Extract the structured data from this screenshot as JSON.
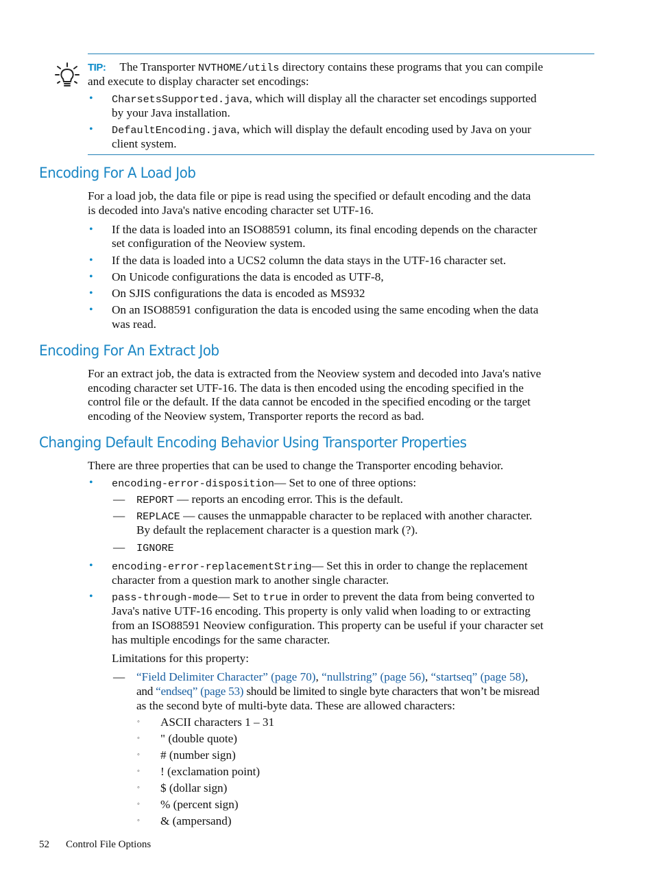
{
  "tip": {
    "label": "TIP:",
    "intro_prefix": "The Transporter ",
    "intro_code": "NVTHOME/utils",
    "intro_suffix": " directory contains these programs that you can compile",
    "intro_line2": "and execute to display character set encodings:",
    "items": [
      {
        "code": "CharsetsSupported.java",
        "text1": ", which will display all the character set encodings supported",
        "text2": "by your Java installation."
      },
      {
        "code": "DefaultEncoding.java",
        "text1": ", which will display the default encoding used by Java on your",
        "text2": "client system."
      }
    ]
  },
  "load_job": {
    "heading": "Encoding For A Load Job",
    "para": [
      "For a load job, the data file or pipe is read using the specified or default encoding and the data",
      "is decoded into Java's native encoding character set UTF-16."
    ],
    "bullets": [
      [
        "If the data is loaded into an ISO88591 column, its final encoding depends on the character",
        "set configuration of the Neoview system."
      ],
      [
        "If the data is loaded into a UCS2 column the data stays in the UTF-16 character set."
      ],
      [
        "On Unicode configurations the data is encoded as UTF-8,"
      ],
      [
        "On SJIS configurations the data is encoded as MS932"
      ],
      [
        "On an ISO88591 configuration the data is encoded using the same encoding when the data",
        "was read."
      ]
    ]
  },
  "extract_job": {
    "heading": "Encoding For An Extract Job",
    "para": [
      "For an extract job, the data is extracted from the Neoview system and decoded into Java's native",
      "encoding character set UTF-16. The data is then encoded using the encoding specified in the",
      "control file or the default. If the data cannot be encoded in the specified encoding or the target",
      "encoding of the Neoview system, Transporter reports the record as bad."
    ]
  },
  "properties": {
    "heading": "Changing Default Encoding Behavior Using Transporter Properties",
    "intro": "There are three properties that can be used to change the Transporter encoding behavior.",
    "disposition": {
      "code": "encoding-error-disposition",
      "text": "— Set to one of three options:",
      "options": [
        {
          "code": "REPORT",
          "text": " — reports an encoding error. This is the default."
        },
        {
          "code": "REPLACE",
          "text": " — causes the unmappable character to be replaced with another character.",
          "text2": "By default the replacement character is a question mark (?)."
        },
        {
          "code": "IGNORE",
          "text": ""
        }
      ]
    },
    "replacement": {
      "code": "encoding-error-replacementString",
      "text1": "— Set this in order to change the replacement",
      "text2": "character from a question mark to another single character."
    },
    "passthrough": {
      "code": "pass-through-mode",
      "text1a": "— Set to ",
      "text1_code": "true",
      "text1b": " in order to prevent the data from being converted to",
      "lines": [
        "Java's native UTF-16 encoding. This property is only valid when loading to or extracting",
        "from an ISO88591 Neoview configuration. This property can be useful if your character set",
        "has multiple encodings for the same character."
      ],
      "limitations_label": "Limitations for this property:",
      "links": [
        "“Field Delimiter Character” (page 70)",
        "“nullstring” (page 56)",
        "“startseq” (page 58)",
        "“endseq” (page 53)"
      ],
      "sep1": ", ",
      "sep2": ", ",
      "sep3": ",",
      "and_text": "and ",
      "limit_text1": " should be limited to single byte characters that won’t be misread",
      "limit_text2": "as the second byte of multi-byte data. These are allowed characters:",
      "allowed_chars": [
        "ASCII characters 1 – 31",
        "\" (double quote)",
        "# (number sign)",
        "! (exclamation point)",
        "$ (dollar sign)",
        "% (percent sign)",
        "& (ampersand)"
      ]
    }
  },
  "footer": {
    "page_number": "52",
    "section": "Control File Options"
  },
  "glyphs": {
    "bullet": "•",
    "dash": "—",
    "circle": "◦"
  }
}
